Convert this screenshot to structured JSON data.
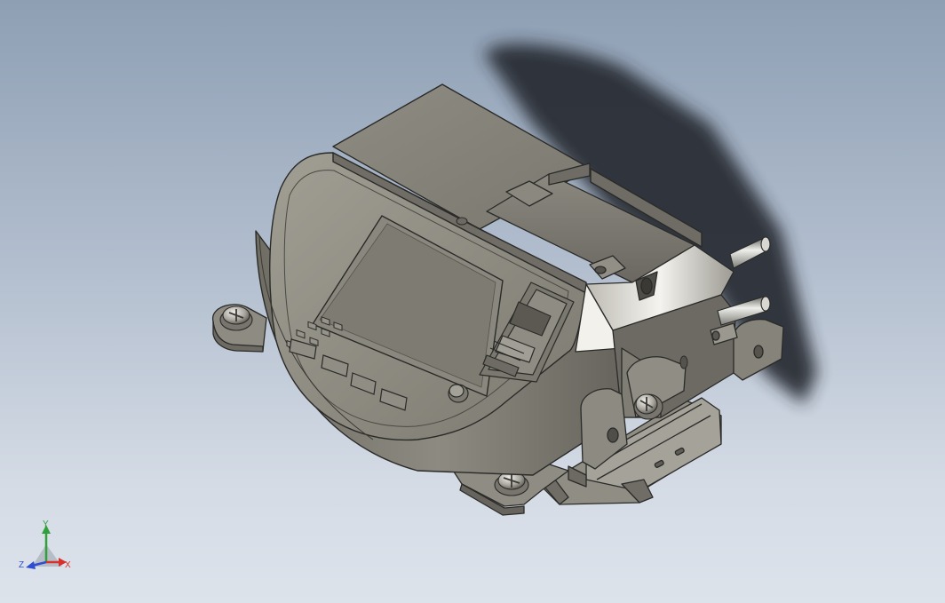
{
  "triad": {
    "x_label": "X",
    "y_label": "Y",
    "z_label": "Z"
  },
  "colors": {
    "background_top": "#8e9fb4",
    "background_bottom": "#dde3eb",
    "housing": "#8c8a7e",
    "housing_dark": "#5f5d55",
    "outline": "#2a2a28",
    "screen": "#8a887e",
    "axis_x": "#d8312b",
    "axis_y": "#2fa03a",
    "axis_z": "#2f4fd0"
  },
  "icons": [
    "screw-icon",
    "din-rail-icon",
    "coordinate-triad-icon"
  ]
}
